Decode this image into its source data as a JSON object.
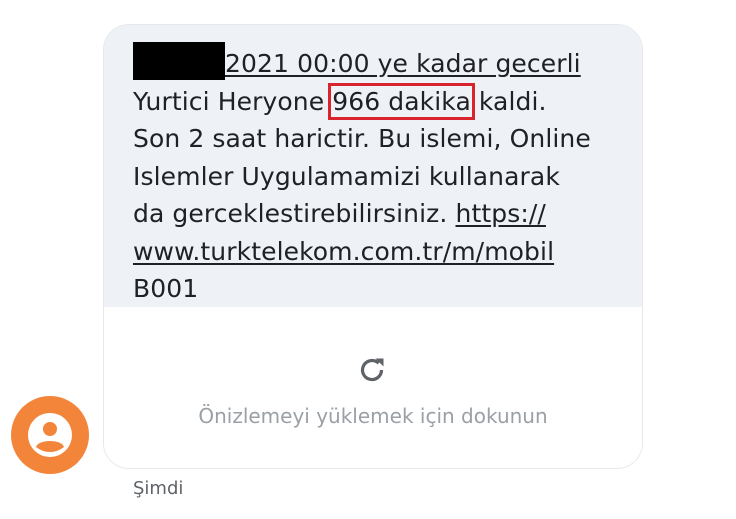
{
  "message": {
    "line1_text": "2021 00:00 ye kadar gecerli",
    "line2_before": "Yurtici Heryone ",
    "line2_highlight": "966 dakika",
    "line2_after": " kaldi.",
    "line3": "Son 2 saat harictir. Bu islemi, Online",
    "line4": "Islemler Uygulamamizi kullanarak",
    "line5_text": "da gerceklestirebilirsiniz. ",
    "line5_link": "https://",
    "line6_link": "www.turktelekom.com.tr/m/mobil",
    "line7": "B001"
  },
  "preview": {
    "label": "Önizlemeyi yüklemek için dokunun",
    "icon": "refresh-icon"
  },
  "timestamp": "Şimdi",
  "avatar": {
    "icon": "person-icon",
    "color": "#f3853a"
  },
  "colors": {
    "bubble_bg": "#eef1f5",
    "highlight_border": "#d9232d",
    "text": "#202124",
    "muted": "#9aa0a6"
  }
}
